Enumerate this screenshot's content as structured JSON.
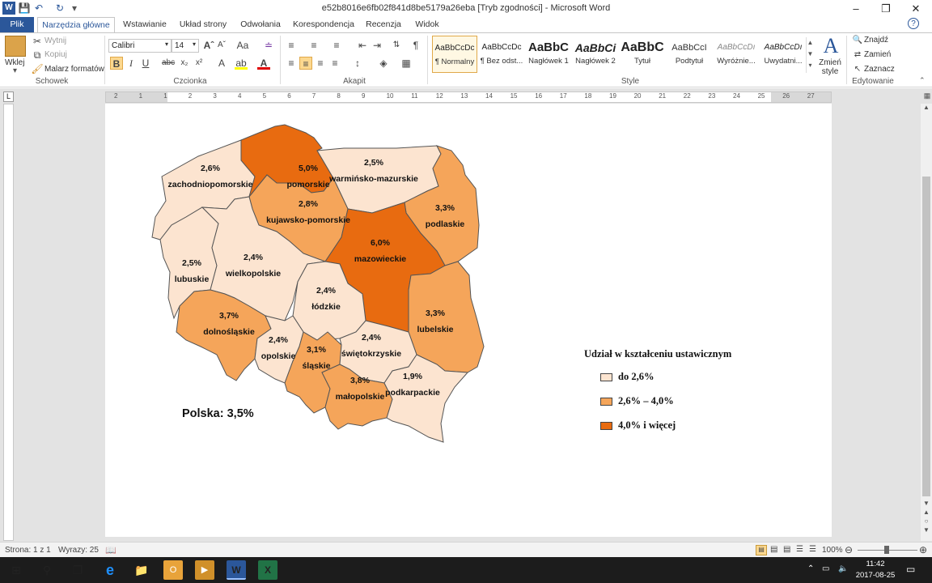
{
  "window": {
    "title": "e52b8016e6fb02f841d8be5179a26eba [Tryb zgodności] - Microsoft Word",
    "help_label": "?"
  },
  "tabs": [
    "Plik",
    "Narzędzia główne",
    "Wstawianie",
    "Układ strony",
    "Odwołania",
    "Korespondencja",
    "Recenzja",
    "Widok"
  ],
  "ribbon": {
    "clipboard": {
      "paste": "Wklej",
      "cut": "Wytnij",
      "copy": "Kopiuj",
      "painter": "Malarz formatów",
      "group": "Schowek"
    },
    "font": {
      "name": "Calibri",
      "size": "14",
      "group": "Czcionka"
    },
    "paragraph": {
      "group": "Akapit"
    },
    "styles": {
      "group": "Style",
      "change_styles": "Zmień style",
      "items": [
        {
          "preview": "AaBbCcDc",
          "name": "¶ Normalny"
        },
        {
          "preview": "AaBbCcDc",
          "name": "¶ Bez odst..."
        },
        {
          "preview": "AaBbC",
          "name": "Nagłówek 1"
        },
        {
          "preview": "AaBbCi",
          "name": "Nagłówek 2"
        },
        {
          "preview": "AaBbC",
          "name": "Tytuł"
        },
        {
          "preview": "AaBbCcI",
          "name": "Podtytuł"
        },
        {
          "preview": "AaBbCcDı",
          "name": "Wyróżnie..."
        },
        {
          "preview": "AaBbCcDı",
          "name": "Uwydatni..."
        }
      ]
    },
    "editing": {
      "find": "Znajdź",
      "replace": "Zamień",
      "select": "Zaznacz",
      "group": "Edytowanie"
    }
  },
  "ruler_numbers": [
    "2",
    "1",
    "1",
    "2",
    "3",
    "4",
    "5",
    "6",
    "7",
    "8",
    "9",
    "10",
    "11",
    "12",
    "13",
    "14",
    "15",
    "16",
    "17",
    "18",
    "19",
    "20",
    "21",
    "22",
    "23",
    "24",
    "25",
    "26",
    "27"
  ],
  "document": {
    "map_total": "Polska: 3,5%",
    "legend_title": "Udział w kształceniu ustawicznym",
    "legend": [
      {
        "label": "do 2,6%",
        "color": "#fce4d0"
      },
      {
        "label": "2,6% – 4,0%",
        "color": "#f5a55a"
      },
      {
        "label": "4,0% i więcej",
        "color": "#e86b10"
      }
    ],
    "regions": [
      {
        "name": "zachodniopomorskie",
        "value": "2,6%"
      },
      {
        "name": "pomorskie",
        "value": "5,0%"
      },
      {
        "name": "warmińsko-mazurskie",
        "value": "2,5%"
      },
      {
        "name": "kujawsko-pomorskie",
        "value": "2,8%"
      },
      {
        "name": "podlaskie",
        "value": "3,3%"
      },
      {
        "name": "mazowieckie",
        "value": "6,0%"
      },
      {
        "name": "lubuskie",
        "value": "2,5%"
      },
      {
        "name": "wielkopolskie",
        "value": "2,4%"
      },
      {
        "name": "łódzkie",
        "value": "2,4%"
      },
      {
        "name": "lubelskie",
        "value": "3,3%"
      },
      {
        "name": "dolnośląskie",
        "value": "3,7%"
      },
      {
        "name": "opolskie",
        "value": "2,4%"
      },
      {
        "name": "śląskie",
        "value": "3,1%"
      },
      {
        "name": "świętokrzyskie",
        "value": "2,4%"
      },
      {
        "name": "małopolskie",
        "value": "3,8%"
      },
      {
        "name": "podkarpackie",
        "value": "1,9%"
      }
    ]
  },
  "status": {
    "page": "Strona: 1 z 1",
    "words": "Wyrazy: 25",
    "zoom": "100%"
  },
  "taskbar": {
    "time": "11:42",
    "date": "2017-08-25"
  }
}
